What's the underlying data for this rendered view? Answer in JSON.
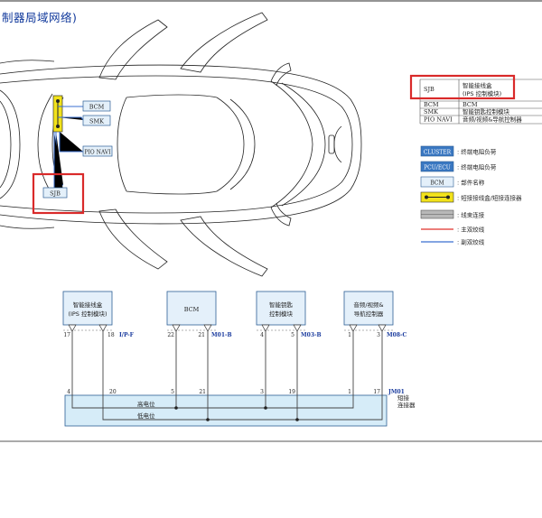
{
  "title": "制器局域网络)",
  "car_labels": {
    "bcm": "BCM",
    "smk": "SMK",
    "pio": "PIO NAVI",
    "sjb": "SJB"
  },
  "legend_table": [
    {
      "code": "SJB",
      "name_line1": "智能接线盒",
      "name_line2": "(IPS 控制模块)"
    },
    {
      "code": "BCM",
      "name": "BCM"
    },
    {
      "code": "SMK",
      "name": "智能钥匙控制模块"
    },
    {
      "code": "PIO NAVI",
      "name": "音频/视频&导航控制器"
    }
  ],
  "legend": [
    {
      "swatch": "CLUSTER",
      "text": ": 终端电阻负荷"
    },
    {
      "swatch": "PCU/ECU",
      "text": ": 终端电阻负荷"
    },
    {
      "swatch": "BCM",
      "text": ": 部件名称"
    },
    {
      "text": ": 短接接线盒/短接连接器"
    },
    {
      "text": ": 线束连接"
    },
    {
      "text": ": 主双绞线"
    },
    {
      "text": ": 副双绞线"
    }
  ],
  "modules": [
    {
      "line1": "智能接线盒",
      "line2": "(IPS 控制模块)",
      "pin_l": "17",
      "pin_r": "18",
      "conn": "I/P-F",
      "bot_l": "4",
      "bot_r": "20"
    },
    {
      "line1": "BCM",
      "line2": "",
      "pin_l": "22",
      "pin_r": "21",
      "conn": "M01-B",
      "bot_l": "5",
      "bot_r": "21"
    },
    {
      "line1": "智能钥匙",
      "line2": "控制模块",
      "pin_l": "4",
      "pin_r": "5",
      "conn": "M03-B",
      "bot_l": "3",
      "bot_r": "19"
    },
    {
      "line1": "音频/视频&",
      "line2": "导航控制器",
      "pin_l": "1",
      "pin_r": "3",
      "conn": "M08-C",
      "bot_l": "1",
      "bot_r": "17"
    }
  ],
  "bus": {
    "high": "高电位",
    "low": "低电位",
    "connector": "JM01",
    "connector_label_line1": "短接",
    "connector_label_line2": "连接器"
  },
  "colors": {
    "main_twisted": "#e0302a",
    "sub_twisted": "#3a6fd0",
    "highlight": "#d92a2a",
    "module_fill": "#e4f0fa",
    "module_border": "#2d5f95",
    "accent": "#1a3b9e",
    "junction": "#f2e21a"
  }
}
